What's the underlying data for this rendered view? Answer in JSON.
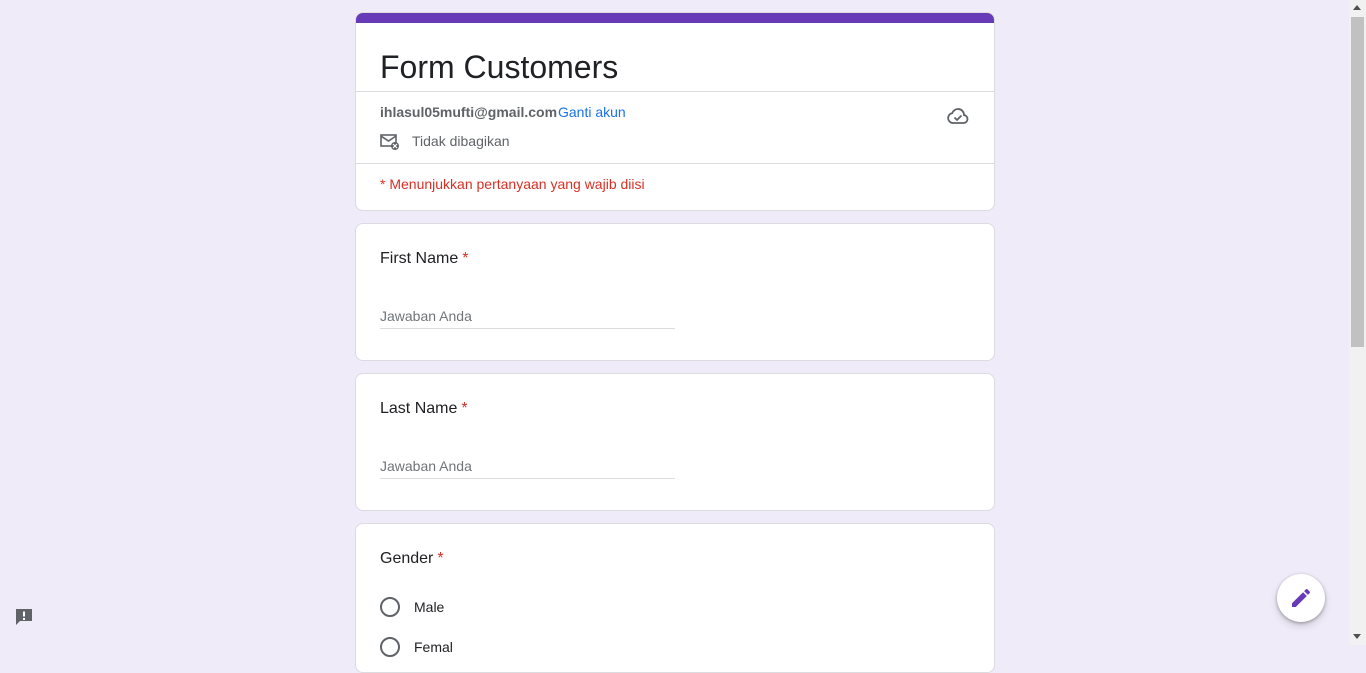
{
  "form": {
    "title": "Form Customers",
    "account_email": "ihlasul05mufti@gmail.com",
    "switch_account": "Ganti akun",
    "share_status": "Tidak dibagikan",
    "required_note": "* Menunjukkan pertanyaan yang wajib diisi"
  },
  "questions": {
    "first_name": {
      "label": "First Name",
      "required_mark": "*",
      "placeholder": "Jawaban Anda"
    },
    "last_name": {
      "label": "Last Name",
      "required_mark": "*",
      "placeholder": "Jawaban Anda"
    },
    "gender": {
      "label": "Gender",
      "required_mark": "*",
      "options": [
        "Male",
        "Femal"
      ]
    }
  },
  "icons": {
    "share": "mail-unshared-icon",
    "cloud": "cloud-saved-icon",
    "feedback": "feedback-icon",
    "edit": "pencil-icon"
  },
  "colors": {
    "accent": "#673ab7",
    "background": "#f0ebf8",
    "required": "#d93025",
    "link": "#1a73e8"
  }
}
